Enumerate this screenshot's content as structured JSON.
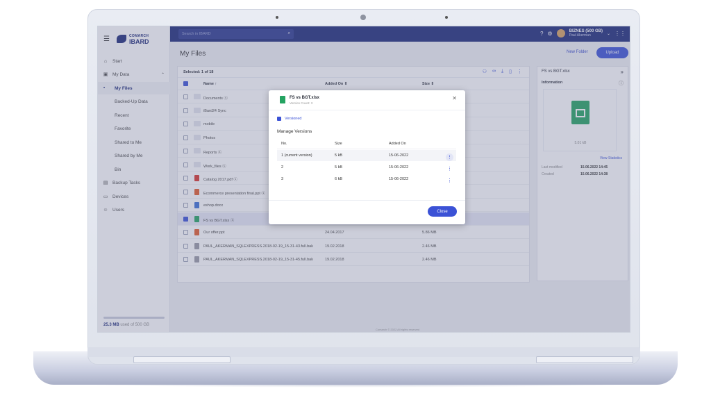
{
  "app": {
    "brand_top": "COMARCH",
    "brand_bottom": "IBARD"
  },
  "sidebar": {
    "items": [
      {
        "label": "Start",
        "icon": "home-icon"
      },
      {
        "label": "My Data",
        "icon": "drive-icon"
      },
      {
        "label": "My Files"
      },
      {
        "label": "Backed-Up Data"
      },
      {
        "label": "Recent"
      },
      {
        "label": "Favorite"
      },
      {
        "label": "Shared to Me"
      },
      {
        "label": "Shared by Me"
      },
      {
        "label": "Bin"
      },
      {
        "label": "Backup Tasks",
        "icon": "clipboard-icon"
      },
      {
        "label": "Devices",
        "icon": "devices-icon"
      },
      {
        "label": "Users",
        "icon": "users-icon"
      }
    ],
    "storage_used": "25.3 MB",
    "storage_rest": " used of 500 GB"
  },
  "topbar": {
    "search_placeholder": "Search in IBARD",
    "plan": "BIZNES (500 GB)",
    "user": "Paul Akerman"
  },
  "main": {
    "title": "My Files",
    "new_folder": "New Folder",
    "upload": "Upload",
    "selected": "Selected: 1 of 18",
    "columns": {
      "name": "Name ↑",
      "added": "Added On ⇕",
      "size": "Size ⇕"
    },
    "rows": [
      {
        "name": "Documents ⓢ",
        "date": "",
        "size": "",
        "type": "folder"
      },
      {
        "name": "iBard24 Sync",
        "date": "",
        "size": "",
        "type": "folder"
      },
      {
        "name": "mobile",
        "date": "",
        "size": "",
        "type": "folder"
      },
      {
        "name": "Photos",
        "date": "",
        "size": "",
        "type": "folder"
      },
      {
        "name": "Reports ⓢ",
        "date": "",
        "size": "",
        "type": "folder"
      },
      {
        "name": "Work_files ⓢ",
        "date": "",
        "size": "",
        "type": "folder"
      },
      {
        "name": "Catalog 2017.pdf ⓢ",
        "date": "",
        "size": "",
        "type": "pdf"
      },
      {
        "name": "Ecommerce presentation final.ppt ⓢ",
        "date": "",
        "size": "",
        "type": "ppt"
      },
      {
        "name": "eshop.docx",
        "date": "",
        "size": "",
        "type": "doc"
      },
      {
        "name": "FS vs BGT.xlsx ⓢ",
        "date": "15.06.2022",
        "size": "5.01 kB",
        "type": "xls"
      },
      {
        "name": "Our offer.ppt",
        "date": "24.04.2017",
        "size": "5.86 MB",
        "type": "ppt"
      },
      {
        "name": "PAUL_AKERMAN_SQLEXPRESS.2018-02-19_15-31-43.full.bak",
        "date": "19.02.2018",
        "size": "2.46 MB",
        "type": "bak"
      },
      {
        "name": "PAUL_AKERMAN_SQLEXPRESS.2018-02-19_15-31-45.full.bak",
        "date": "19.02.2018",
        "size": "2.46 MB",
        "type": "bak"
      }
    ],
    "footer": "Comarch © 2022 All rights reserved"
  },
  "detail": {
    "title": "FS vs BGT.xlsx",
    "info": "Information",
    "size": "5.01 kB",
    "view_stats": "View Statistics",
    "last_modified_label": "Last modified",
    "last_modified": "15.06.2022 14:45",
    "created_label": "Created",
    "created": "15.06.2022 14:38"
  },
  "modal": {
    "title": "FS vs BGT.xlsx",
    "subtitle": "Version Count: 3",
    "versioned": "Versioned",
    "manage": "Manage Versions",
    "col_no": "No.",
    "col_size": "Size",
    "col_added": "Added On",
    "versions": [
      {
        "no": "1 (current version)",
        "size": "5 kB",
        "date": "15-06-2022"
      },
      {
        "no": "2",
        "size": "5 kB",
        "date": "15-06-2022"
      },
      {
        "no": "3",
        "size": "6 kB",
        "date": "15-06-2022"
      }
    ],
    "close": "Close"
  },
  "colors": {
    "brand": "#1d2a78",
    "accent": "#3b52d6",
    "excel": "#24a361"
  }
}
